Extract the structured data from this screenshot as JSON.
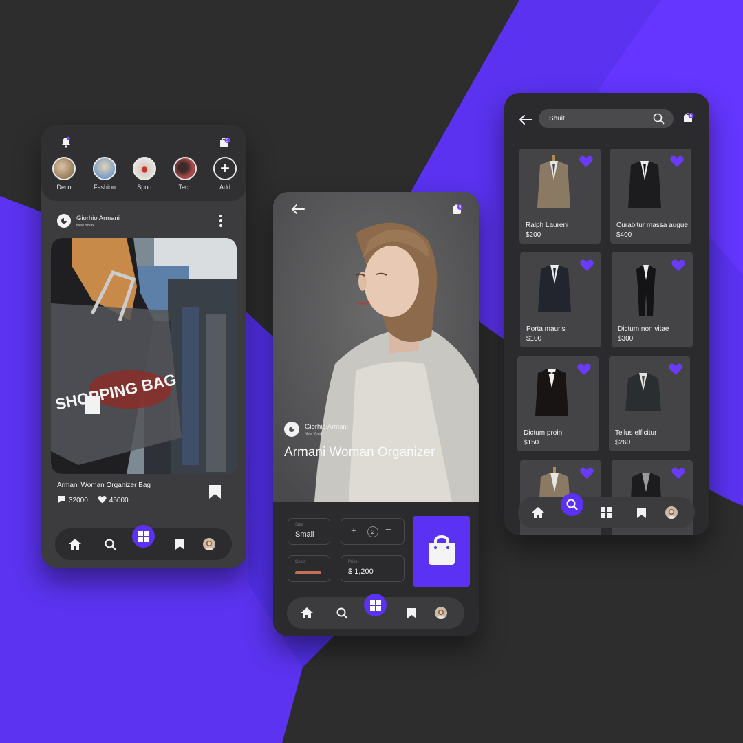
{
  "colors": {
    "accent": "#5b31f4",
    "background": "#2d2d2d",
    "panel": "#3c3c3e",
    "dark_panel": "#2b2b2d"
  },
  "feed": {
    "cart_badge": "5",
    "stories": [
      {
        "label": "Deco"
      },
      {
        "label": "Fashion"
      },
      {
        "label": "Sport"
      },
      {
        "label": "Tech"
      },
      {
        "label": "Add"
      }
    ],
    "author": {
      "name": "Giorhio Armani",
      "location": "New Yourk"
    },
    "photo_text": "SHOPPING BAG",
    "caption": "Armani Woman Organizer Bag",
    "comments": "32000",
    "likes": "45000"
  },
  "detail": {
    "cart_badge": "5",
    "author": {
      "name": "Giorhio Armani",
      "location": "New Yourk"
    },
    "title": "Armani Woman Organizer",
    "size_label": "Size",
    "size_value": "Small",
    "quantity": "2",
    "plus": "+",
    "minus": "−",
    "color_label": "Color",
    "price_label": "Price",
    "price_value": "$ 1,200"
  },
  "search": {
    "cart_badge": "5",
    "query": "Shuit",
    "products": [
      {
        "name": "Ralph Laureni",
        "price": "$200"
      },
      {
        "name": "Curabitur massa augue",
        "price": "$400"
      },
      {
        "name": "Porta mauris",
        "price": "$100"
      },
      {
        "name": "Dictum non vitae",
        "price": "$300"
      },
      {
        "name": "Dictum proin",
        "price": "$150"
      },
      {
        "name": "Tellus efficitur",
        "price": "$260"
      }
    ]
  },
  "icons": [
    "bell-icon",
    "shopping-bag-icon",
    "plus-icon",
    "more-vertical-icon",
    "comment-icon",
    "heart-icon",
    "bookmark-icon",
    "home-icon",
    "search-icon",
    "grid-icon",
    "back-arrow-icon"
  ]
}
